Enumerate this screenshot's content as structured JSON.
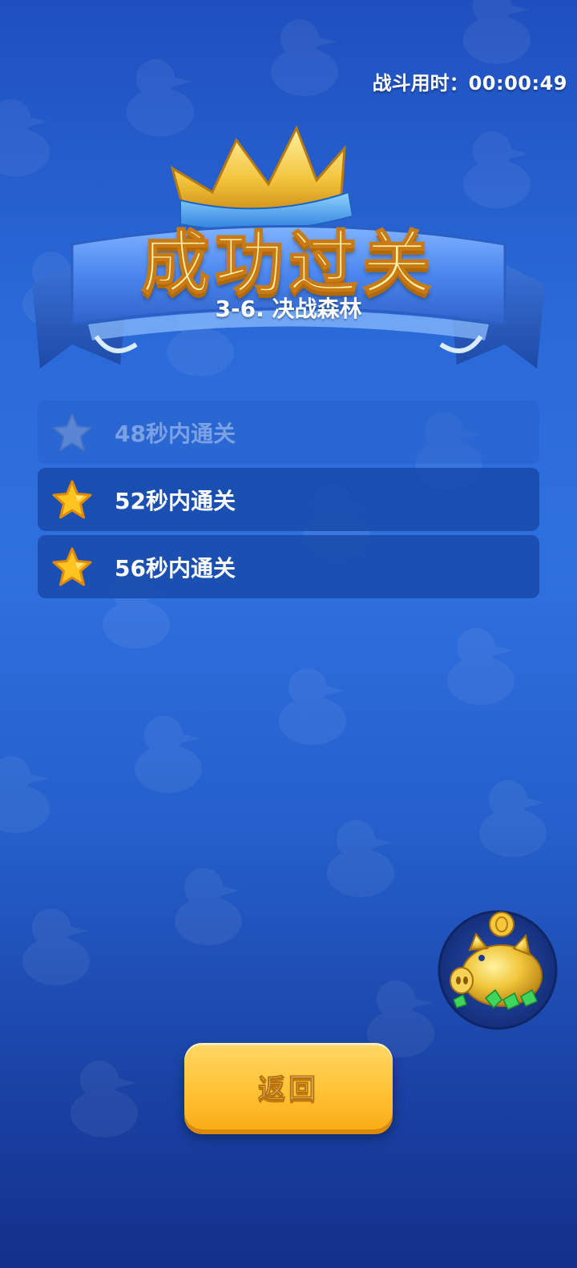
{
  "header": {
    "timer_label": "战斗用时：",
    "timer_value": "00:00:49"
  },
  "result": {
    "title": "成功过关",
    "level": "3-6. 决战森林"
  },
  "objectives": [
    {
      "label": "48秒内通关",
      "achieved": false
    },
    {
      "label": "52秒内通关",
      "achieved": true
    },
    {
      "label": "56秒内通关",
      "achieved": true
    }
  ],
  "actions": {
    "return_label": "返回"
  },
  "icons": {
    "star": "star-icon",
    "piggy_bank": "piggy-bank-icon",
    "crown": "crown-icon"
  },
  "colors": {
    "star_gold": "#ffc41f",
    "star_locked": "#5b86d6",
    "button_yellow": "#ffc53a",
    "title_gold": "#fff2a8"
  }
}
